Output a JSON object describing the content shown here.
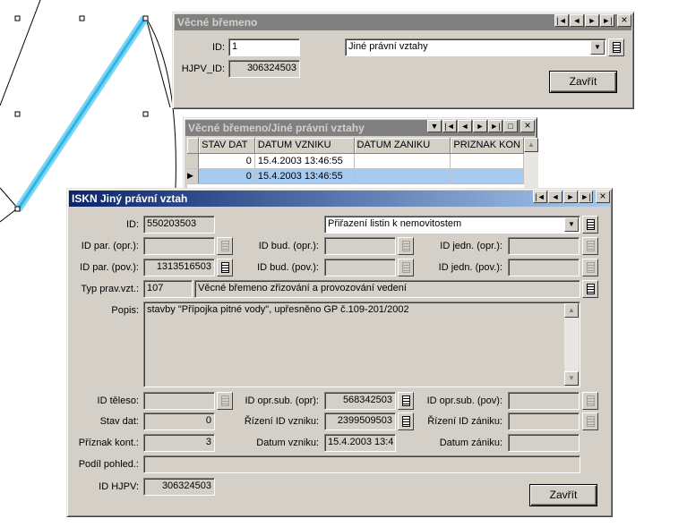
{
  "vecne_bremeno": {
    "title": "Věcné břemeno",
    "id_label": "ID:",
    "id_value": "1",
    "hjpv_label": "HJPV_ID:",
    "hjpv_value": "306324503",
    "type_value": "Jiné právní vztahy",
    "close": "Zavřít"
  },
  "grid": {
    "title": "Věcné břemeno/Jiné právní vztahy",
    "columns": [
      "STAV DAT",
      "DATUM VZNIKU",
      "DATUM ZANIKU",
      "PRIZNAK KON"
    ],
    "rows": [
      {
        "stav": "0",
        "vznik": "15.4.2003 13:46:55",
        "zanik": "",
        "priznak": ""
      },
      {
        "stav": "0",
        "vznik": "15.4.2003 13:46:55",
        "zanik": "",
        "priznak": ""
      }
    ]
  },
  "iskn": {
    "title": "ISKN Jiný právní vztah",
    "id_label": "ID:",
    "id_value": "550203503",
    "assignment_value": "Přiřazení listin k nemovitostem",
    "id_par_opr_label": "ID par. (opr.):",
    "id_par_opr": "",
    "id_bud_opr_label": "ID bud. (opr.):",
    "id_bud_opr": "",
    "id_jedn_opr_label": "ID jedn. (opr.):",
    "id_jedn_opr": "",
    "id_par_pov_label": "ID par. (pov.):",
    "id_par_pov": "1313516503",
    "id_bud_pov_label": "ID bud. (pov.):",
    "id_bud_pov": "",
    "id_jedn_pov_label": "ID jedn. (pov.):",
    "id_jedn_pov": "",
    "typ_label": "Typ prav.vzt.:",
    "typ_code": "107",
    "typ_text": "Věcné břemeno zřizování a provozování vedení",
    "popis_label": "Popis:",
    "popis": "stavby \"Přípojka pitné vody\", upřesněno GP č.109-201/2002",
    "teleso_label": "ID těleso:",
    "teleso": "",
    "opr_sub_opr_label": "ID opr.sub. (opr):",
    "opr_sub_opr": "568342503",
    "opr_sub_pov_label": "ID opr.sub. (pov):",
    "opr_sub_pov": "",
    "stav_label": "Stav dat:",
    "stav": "0",
    "rizeni_vzniku_label": "Řízení ID vzniku:",
    "rizeni_vzniku": "2399509503",
    "rizeni_zaniku_label": "Řízení ID zániku:",
    "rizeni_zaniku": "",
    "priznak_label": "Příznak kont.:",
    "priznak": "3",
    "datum_vzniku_label": "Datum vzniku:",
    "datum_vzniku": "15.4.2003 13:4",
    "datum_zaniku_label": "Datum zániku:",
    "datum_zaniku": "",
    "podil_label": "Podíl pohled.:",
    "podil": "",
    "hjpv_label": "ID HJPV:",
    "hjpv": "306324503",
    "close": "Zavřít"
  },
  "colors": {
    "highlight": "#2cb6e8",
    "active_title": "#0a246a",
    "inactive_title": "#808080"
  }
}
